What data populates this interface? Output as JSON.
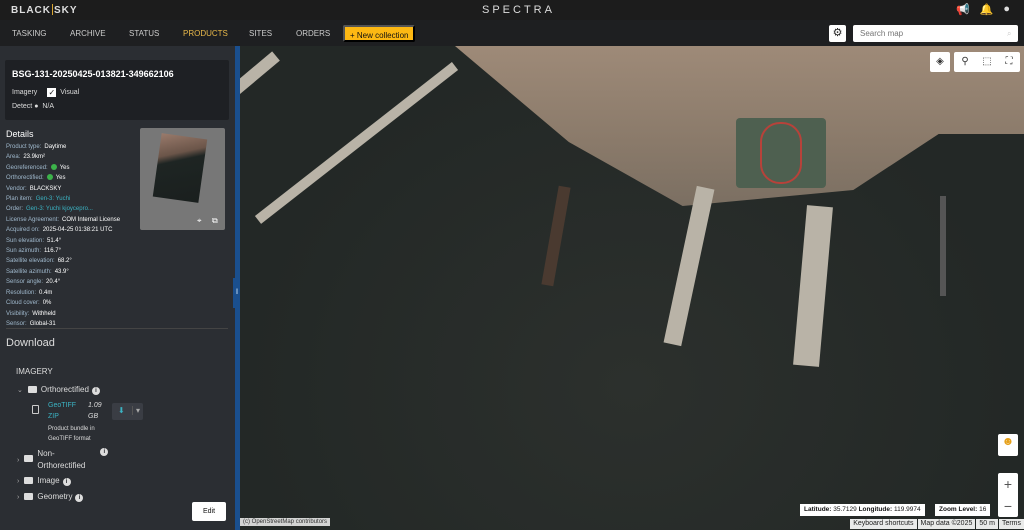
{
  "header": {
    "logo": "BLACKSKY",
    "app_title": "SPECTRA"
  },
  "nav": {
    "items": [
      "TASKING",
      "ARCHIVE",
      "STATUS",
      "PRODUCTS",
      "SITES",
      "ORDERS"
    ],
    "active": "PRODUCTS",
    "new_collection": "+ New collection"
  },
  "search": {
    "placeholder": "Search map"
  },
  "product": {
    "id": "BSG-131-20250425-013821-349662106",
    "imagery_label": "Imagery",
    "imagery_value": "Visual",
    "detect_label": "Detect",
    "detect_value": "N/A"
  },
  "details": {
    "title": "Details",
    "rows": [
      {
        "k": "Product type:",
        "v": "Daytime"
      },
      {
        "k": "Area:",
        "v": "23.9km²"
      },
      {
        "k": "Georeferenced:",
        "v": "Yes",
        "check": true
      },
      {
        "k": "Orthorectified:",
        "v": "Yes",
        "check": true
      },
      {
        "k": "Vendor:",
        "v": "BLACKSKY"
      },
      {
        "k": "Plan item:",
        "v": "Gen-3: Yuchi",
        "link": true
      },
      {
        "k": "Order:",
        "v": "Gen-3: Yuchi kjoycepro...",
        "link": true
      },
      {
        "k": "License Agreement:",
        "v": "COM Internal License"
      },
      {
        "k": "Acquired on:",
        "v": "2025-04-25  01:38:21 UTC"
      },
      {
        "k": "Sun elevation:",
        "v": "51.4°"
      },
      {
        "k": "Sun azimuth:",
        "v": "116.7°"
      },
      {
        "k": "Satellite elevation:",
        "v": "68.2°"
      },
      {
        "k": "Satellite azimuth:",
        "v": "43.9°"
      },
      {
        "k": "Sensor angle:",
        "v": "20.4°"
      },
      {
        "k": "Resolution:",
        "v": "0.4m"
      },
      {
        "k": "Cloud cover:",
        "v": "0%"
      },
      {
        "k": "Visibility:",
        "v": "Withheld"
      },
      {
        "k": "Sensor:",
        "v": "Global-31"
      }
    ]
  },
  "download": {
    "title": "Download",
    "section": "IMAGERY",
    "folders": [
      "Orthorectified",
      "Non-Orthorectified",
      "Image",
      "Geometry"
    ],
    "file": {
      "format": "GeoTIFF",
      "type": "ZIP",
      "size": "1.09",
      "unit": "GB",
      "desc1": "Product bundle in",
      "desc2": "GeoTIFF format"
    },
    "edit": "Edit"
  },
  "map": {
    "latitude_label": "Latitude:",
    "latitude": "35.7129",
    "longitude_label": "Longitude:",
    "longitude": "119.9974",
    "zoom_label": "Zoom Level:",
    "zoom": "16",
    "attribution": "(c) OpenStreetMap contributors",
    "footer": [
      "Keyboard shortcuts",
      "Map data ©2025",
      "50 m",
      "Terms"
    ]
  }
}
